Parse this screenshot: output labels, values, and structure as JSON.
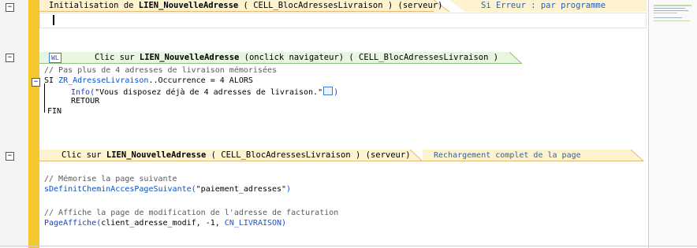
{
  "events": [
    {
      "title_prefix": "Initialisation de ",
      "control": "LIEN_NouvelleAdresse",
      "context": " ( CELL_BlocAdressesLivraison ) (serveur)",
      "option": "Si Erreur : par programme"
    },
    {
      "badge": "WL",
      "title_prefix": "Clic sur ",
      "control": "LIEN_NouvelleAdresse",
      "context": " (onclick navigateur)  ( CELL_BlocAdressesLivraison )"
    },
    {
      "title_prefix": "Clic sur ",
      "control": "LIEN_NouvelleAdresse",
      "context": " ( CELL_BlocAdressesLivraison ) (serveur)",
      "option": "Rechargement complet de la page"
    }
  ],
  "code": {
    "b2_comment": "// Pas plus de 4 adresses de livraison mémorisées",
    "b2_si": "SI ",
    "b2_var": "ZR_AdresseLivraison",
    "b2_cond": "..Occurrence = 4 ALORS",
    "b2_info": "Info(",
    "b2_str": "\"Vous disposez déjà de 4 adresses de livraison.\"",
    "b2_close": ")",
    "b2_retour": "RETOUR",
    "b2_fin": "FIN",
    "b3_comment1": "// Mémorise la page suivante",
    "b3_proc": "sDefinitCheminAccesPageSuivante(",
    "b3_str": "\"paiement_adresses\"",
    "b3_close1": ")",
    "b3_comment2": "// Affiche la page de modification de l'adresse de facturation",
    "b3_fn": "PageAffiche(",
    "b3_args": "client_adresse_modif, -1, ",
    "b3_const": "CN_LIVRAISON",
    "b3_close2": ")"
  },
  "colors": {
    "header_fill": "#fdf3cf",
    "header_fill_green": "#e6f6df",
    "header_line_green": "#8ec27e",
    "header_line_orange": "#e8b870",
    "option_text": "#2a5fb5",
    "accent_bar": "#f7c72e"
  }
}
